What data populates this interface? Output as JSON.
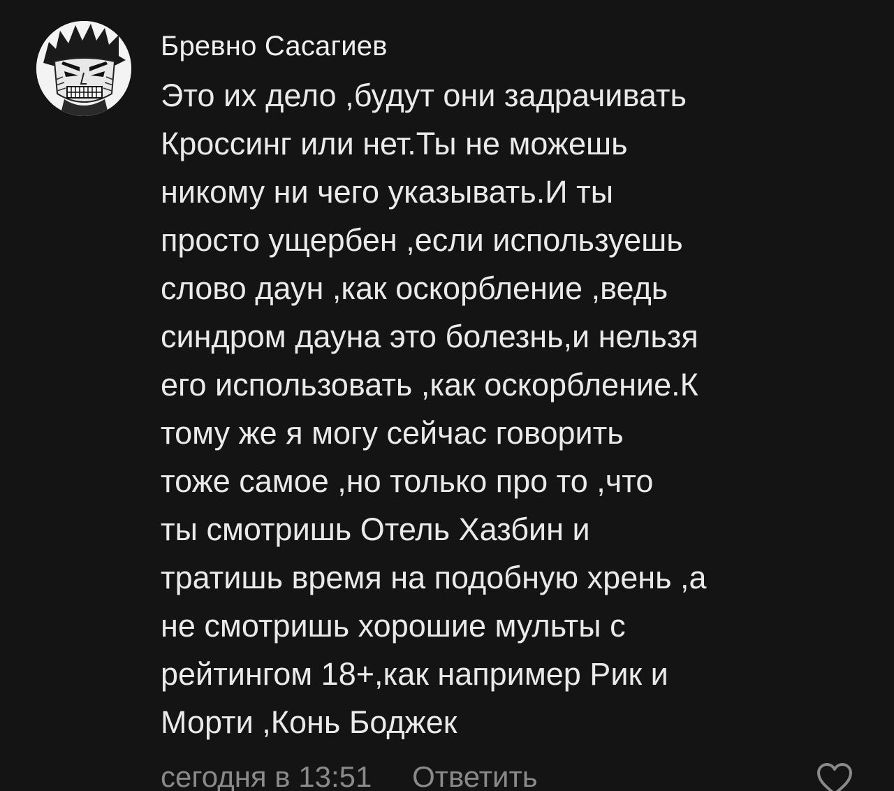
{
  "comment": {
    "author": "Бревно Сасагиев",
    "avatar_icon": "manga-face-avatar",
    "text_lines": [
      "Это их дело ,будут они задрачивать",
      "Кроссинг или нет.Ты не можешь",
      "никому ни чего указывать.И ты",
      "просто ущербен ,если используешь",
      "слово даун ,как оскорбление ,ведь",
      "синдром дауна это болезнь,и нельзя",
      "его использовать ,как оскорбление.К",
      "тому же я могу сейчас говорить",
      "тоже самое ,но только про то ,что",
      "ты смотришь Отель Хазбин и",
      "тратишь время на подобную хрень ,а",
      "не смотришь хорошие мульты с",
      "рейтингом 18+,как например Рик и",
      "Морти ,Конь Боджек"
    ],
    "timestamp": "сегодня в 13:51",
    "reply_label": "Ответить",
    "like_icon": "heart-outline-icon"
  },
  "colors": {
    "background": "#141414",
    "text": "#eaeaea",
    "meta": "#8a8a8a"
  }
}
